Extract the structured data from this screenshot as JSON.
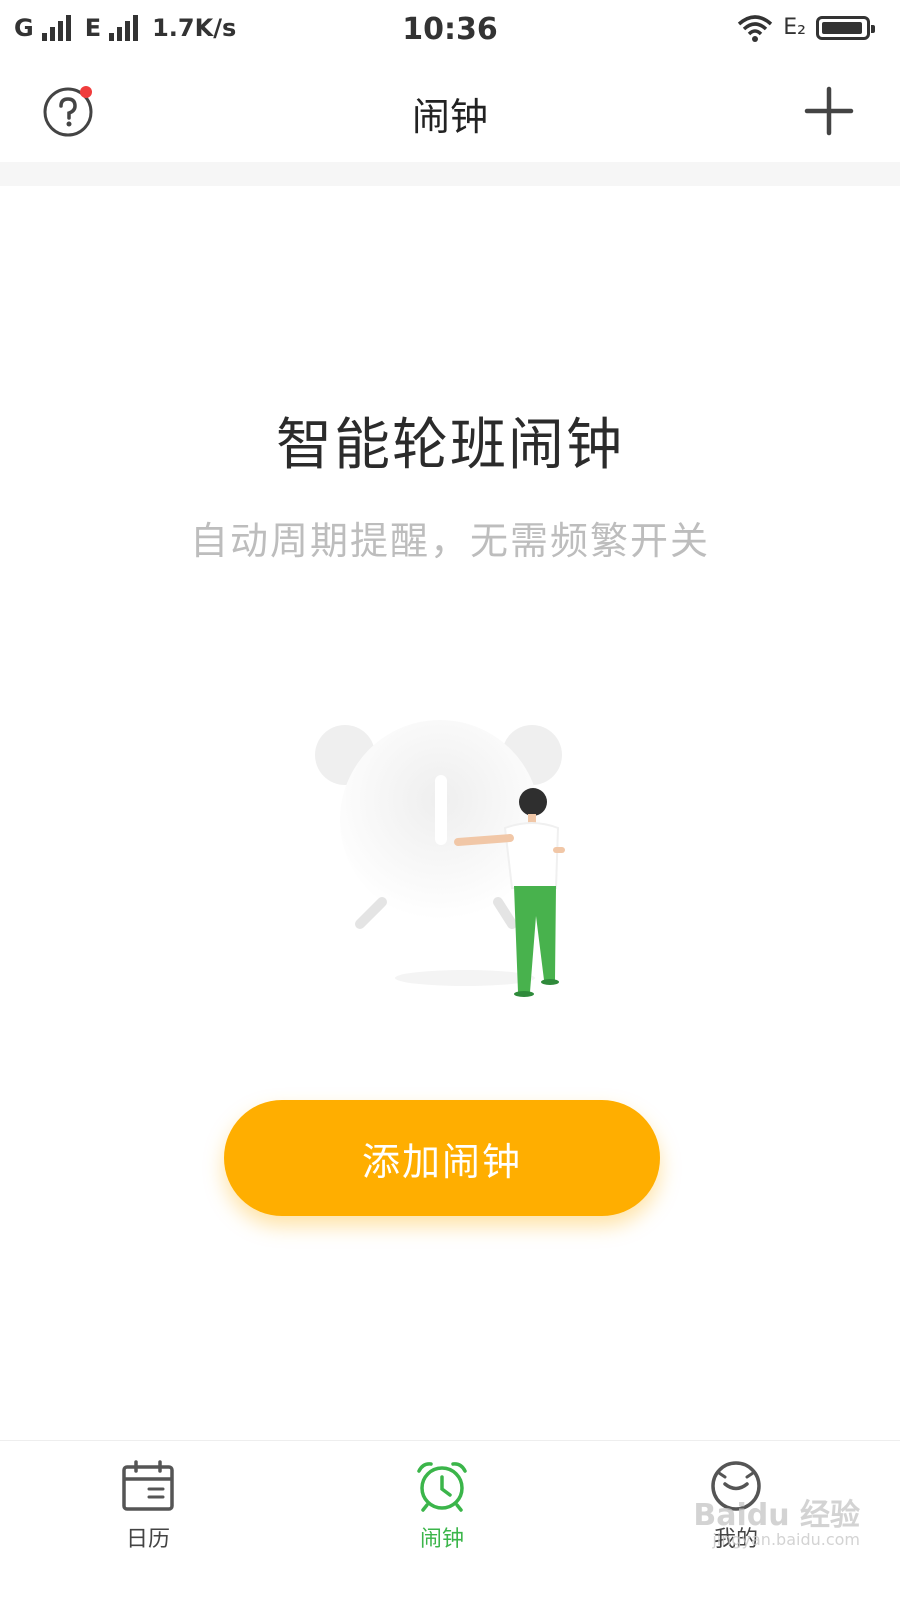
{
  "status_bar": {
    "network1": "G",
    "network2": "E",
    "speed": "1.7K/s",
    "time": "10:36",
    "extra": "E₂",
    "battery_level": 0.85
  },
  "header": {
    "title": "闹钟",
    "help_icon": "help-circle-icon",
    "add_icon": "plus-icon",
    "notification_dot_color": "#F03C3C"
  },
  "main": {
    "heading": "智能轮班闹钟",
    "subheading": "自动周期提醒，无需频繁开关",
    "add_button_label": "添加闹钟"
  },
  "tabs": [
    {
      "label": "日历",
      "icon": "calendar-icon",
      "active": false
    },
    {
      "label": "闹钟",
      "icon": "alarm-clock-icon",
      "active": true
    },
    {
      "label": "我的",
      "icon": "face-icon",
      "active": false
    }
  ],
  "watermark": {
    "brand": "Baidu 经验",
    "url": "jingyan.baidu.com"
  },
  "colors": {
    "accent": "#FFAE00",
    "active_tab": "#3BB54A",
    "subtitle": "#BDBDBD"
  }
}
